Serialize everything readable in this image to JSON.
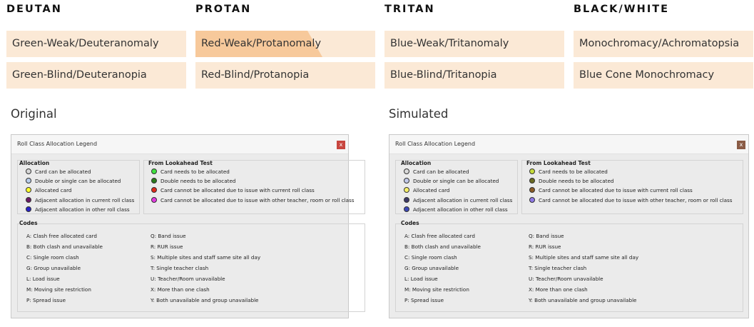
{
  "headers": [
    "DEUTAN",
    "PROTAN",
    "TRITAN",
    "BLACK/WHITE"
  ],
  "options": [
    [
      "Green-Weak/Deuteranomaly",
      "Green-Blind/Deuteranopia"
    ],
    [
      "Red-Weak/Protanomaly",
      "Red-Blind/Protanopia"
    ],
    [
      "Blue-Weak/Tritanomaly",
      "Blue-Blind/Tritanopia"
    ],
    [
      "Monochromacy/Achromatopsia",
      "Blue Cone Monochromacy"
    ]
  ],
  "selected_option": "Red-Weak/Protanomaly",
  "original_label": "Original",
  "simulated_label": "Simulated",
  "window": {
    "title": "Roll Class Allocation Legend",
    "close_label": "x",
    "allocation_heading": "Allocation",
    "lookahead_heading": "From Lookahead Test",
    "codes_heading": "Codes",
    "allocation_items": [
      "Card can be allocated",
      "Double or single can be allocated",
      "Allocated card",
      "Adjacent allocation in current roll class",
      "Adjacent allocation in other roll class"
    ],
    "lookahead_items": [
      "Card needs to be allocated",
      "Double needs to be allocated",
      "Card cannot be allocated due to issue with current roll class",
      "Card cannot be allocated due to issue with other teacher, room or roll class"
    ],
    "codes_left": [
      "A: Clash free allocated card",
      "B: Both clash and unavailable",
      "C: Single room clash",
      "G: Group unavailable",
      "L: Load issue",
      "M: Moving site restriction",
      "P: Spread issue"
    ],
    "codes_right": [
      "Q: Band issue",
      "R: RUR issue",
      "S: Multiple sites and staff same site all day",
      "T: Single teacher clash",
      "U: Teacher/Room unavailable",
      "X: More than one clash",
      "Y: Both unavailable and group unavailable"
    ]
  },
  "colors": {
    "option_bg": "#fbe9d6",
    "option_selected": "#f7c99b",
    "original_close": "#c8463f",
    "simulated_close": "#8a5b45",
    "original_allocation": [
      "#d6d6d6",
      "#b8cdea",
      "#ffff2a",
      "#6b1a66",
      "#2a22c8"
    ],
    "original_lookahead": [
      "#3fe23f",
      "#2b7a1c",
      "#e02a1a",
      "#e23ae0"
    ],
    "simulated_allocation": [
      "#d9d9d9",
      "#c2c9e8",
      "#f6f06a",
      "#3d3966",
      "#3e49b8"
    ],
    "simulated_lookahead": [
      "#c7dc3a",
      "#6a6a22",
      "#8a5b25",
      "#8e78e6"
    ]
  }
}
